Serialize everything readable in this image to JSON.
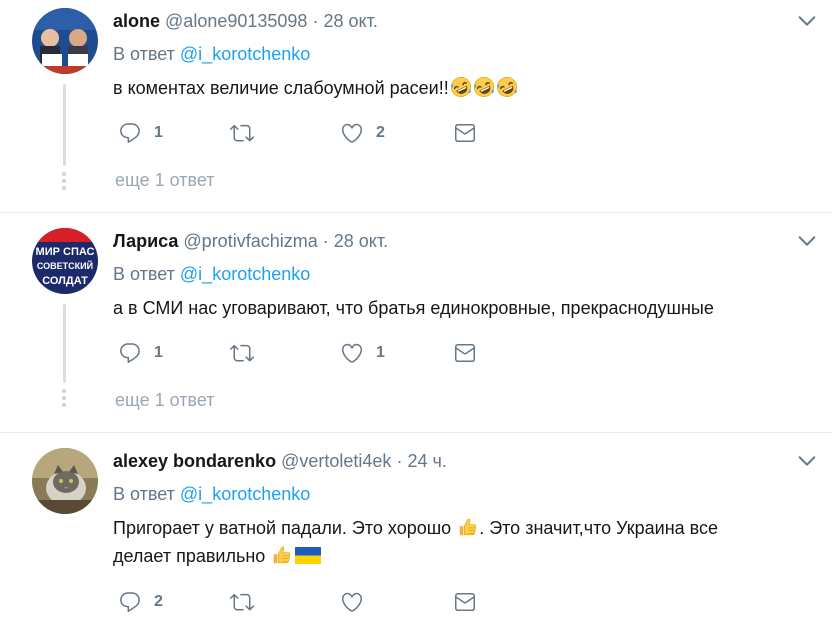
{
  "tweets": [
    {
      "name": "alone",
      "handle": "@alone90135098",
      "separator": "·",
      "time": "28 окт.",
      "reply_prefix": "В ответ",
      "reply_mention": "@i_korotchenko",
      "text": "в коментах величие слабоумной расеи!!",
      "emoji": [
        "rofl-emoji",
        "rofl-emoji",
        "rofl-emoji"
      ],
      "reply_count": "1",
      "retweet_count": "",
      "like_count": "2",
      "more_replies": "еще 1 ответ"
    },
    {
      "name": "Лариса",
      "handle": "@protivfachizma",
      "separator": "·",
      "time": "28 окт.",
      "reply_prefix": "В ответ",
      "reply_mention": "@i_korotchenko",
      "text": "а в СМИ нас уговаривают, что братья единокровные, прекраснодушные",
      "reply_count": "1",
      "retweet_count": "",
      "like_count": "1",
      "more_replies": "еще 1 ответ",
      "avatar_text": [
        "МИР СПАС",
        "СОВЕТСКИЙ",
        "СОЛДАТ"
      ]
    },
    {
      "name": "alexey bondarenko",
      "handle": "@vertoleti4ek",
      "separator": "·",
      "time": "24 ч.",
      "reply_prefix": "В ответ",
      "reply_mention": "@i_korotchenko",
      "text_line1": "Пригорает у ватной падали. Это хорошо",
      "text_line1_after": ". Это значит,что Украина все",
      "text_line2": "делает правильно",
      "reply_count": "2",
      "retweet_count": "",
      "like_count": ""
    }
  ],
  "colors": {
    "accent": "#1da1f2",
    "secondary_text": "#657786",
    "divider": "#e6ecf0"
  }
}
